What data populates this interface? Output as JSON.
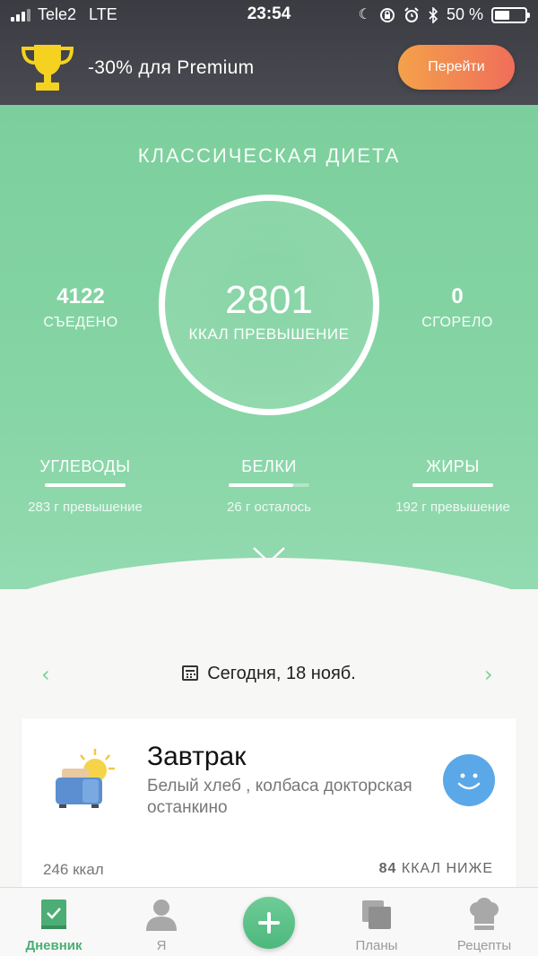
{
  "status_bar": {
    "carrier": "Tele2",
    "network": "LTE",
    "time": "23:54",
    "battery": "50 %",
    "battery_level": 0.5,
    "icons": [
      "moon-icon",
      "orientation-lock-icon",
      "alarm-icon",
      "bluetooth-icon"
    ]
  },
  "promo": {
    "text": "-30% для Premium",
    "button_label": "Перейти",
    "trophy_color": "#f5d220"
  },
  "summary": {
    "diet_title": "КЛАССИЧЕСКАЯ ДИЕТА",
    "eaten_value": "4122",
    "eaten_label": "СЪЕДЕНО",
    "kcal_value": "2801",
    "kcal_label": "ККАЛ ПРЕВЫШЕНИЕ",
    "burned_value": "0",
    "burned_label": "СГОРЕЛО",
    "macros": [
      {
        "name": "УГЛЕВОДЫ",
        "sub": "283 г превышение",
        "progress": 1.0
      },
      {
        "name": "БЕЛКИ",
        "sub": "26 г осталось",
        "progress": 0.8
      },
      {
        "name": "ЖИРЫ",
        "sub": "192 г превышение",
        "progress": 1.0
      }
    ],
    "accent_color": "#7ccf9c"
  },
  "date_nav": {
    "label": "Сегодня, 18 нояб."
  },
  "meal": {
    "title": "Завтрак",
    "description": "Белый хлеб , колбаса докторская останкино",
    "kcal": "246 ккал",
    "diff_number": "84",
    "diff_text": "ККАЛ НИЖЕ",
    "mood_color": "#5aa8e8"
  },
  "tabbar": {
    "tabs": [
      {
        "label": "Дневник",
        "icon": "diary-icon",
        "active": true
      },
      {
        "label": "Я",
        "icon": "profile-icon",
        "active": false
      },
      {
        "label": "Планы",
        "icon": "plans-icon",
        "active": false
      },
      {
        "label": "Рецепты",
        "icon": "chef-hat-icon",
        "active": false
      }
    ],
    "add_icon": "plus-icon"
  }
}
